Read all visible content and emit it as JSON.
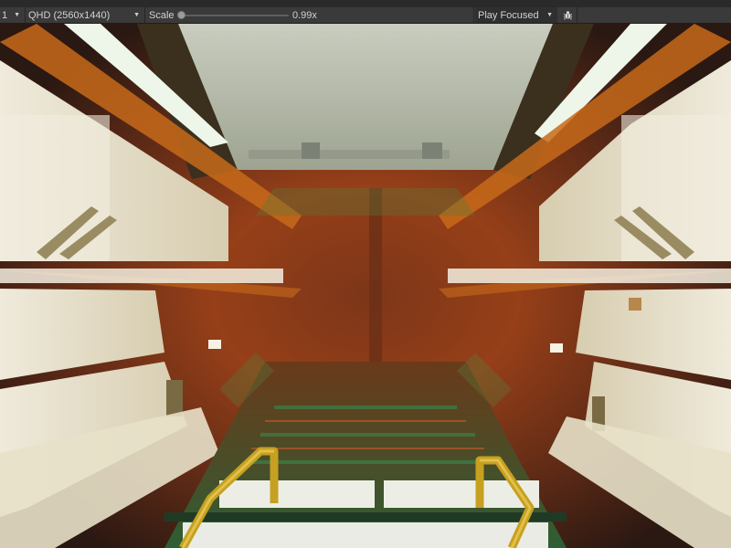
{
  "toolbar": {
    "display": "1",
    "aspect": "QHD (2560x1440)",
    "scale_label": "Scale",
    "scale_value": "0.99x",
    "play_mode": "Play Focused",
    "bug_icon": "bug-icon"
  },
  "game_view": {
    "scene": "sci-fi corridor with radial motion blur",
    "colors": {
      "rust": "#8a3a1c",
      "orange": "#c66a1a",
      "panel": "#e9e4cf",
      "floor_green": "#2f6a3a",
      "rail_yellow": "#c7a021"
    }
  }
}
